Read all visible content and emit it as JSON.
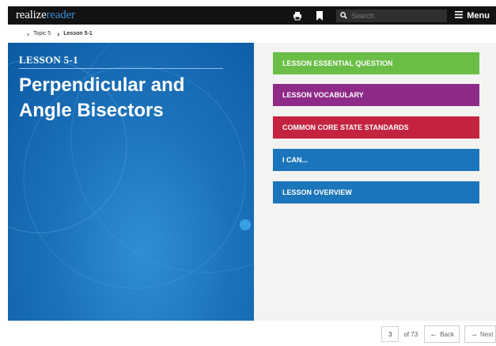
{
  "header": {
    "brand_realize": "realize",
    "brand_reader": "reader",
    "search_placeholder": "Search",
    "menu_label": "Menu",
    "icons": [
      "print-icon",
      "bookmark-icon",
      "search-icon",
      "hamburger-icon"
    ]
  },
  "breadcrumb": {
    "items": [
      {
        "label": "Topic 5"
      },
      {
        "label": "Lesson 5-1"
      }
    ]
  },
  "hero": {
    "lesson_number": "LESSON 5-1",
    "title_line1": "Perpendicular and",
    "title_line2": "Angle Bisectors"
  },
  "lesson_links": [
    {
      "label": "LESSON ESSENTIAL QUESTION",
      "color": "#6abe45"
    },
    {
      "label": "LESSON VOCABULARY",
      "color": "#8e2a87"
    },
    {
      "label": "COMMON CORE STATE STANDARDS",
      "color": "#c4233f"
    },
    {
      "label": "I CAN...",
      "color": "#1b75bb"
    },
    {
      "label": "LESSON OVERVIEW",
      "color": "#1b75bb"
    }
  ],
  "pager": {
    "current_page": "3",
    "of_total": "of 73",
    "back_label": "Back",
    "next_label": "Next"
  }
}
